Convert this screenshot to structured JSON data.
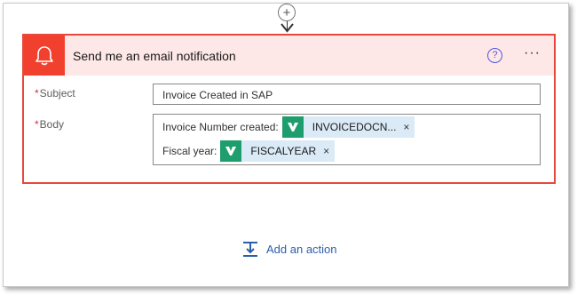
{
  "connector": {
    "insert_symbol": "+"
  },
  "action": {
    "title": "Send me an email notification",
    "header_icon": "bell-icon",
    "help_symbol": "?",
    "more_symbol": "···",
    "colors": {
      "accent": "#f2402e",
      "header_bg": "#fde7e7",
      "border": "#e8473c"
    }
  },
  "fields": {
    "subject": {
      "required_marker": "*",
      "label": "Subject",
      "value": "Invoice Created in SAP"
    },
    "body": {
      "required_marker": "*",
      "label": "Body",
      "lines": [
        {
          "text": "Invoice Number created:",
          "token": "INVOICEDOCN...",
          "remove_symbol": "×"
        },
        {
          "text": "Fiscal year:",
          "token": "FISCALYEAR",
          "remove_symbol": "×"
        }
      ]
    }
  },
  "footer": {
    "add_action_label": "Add an action"
  }
}
